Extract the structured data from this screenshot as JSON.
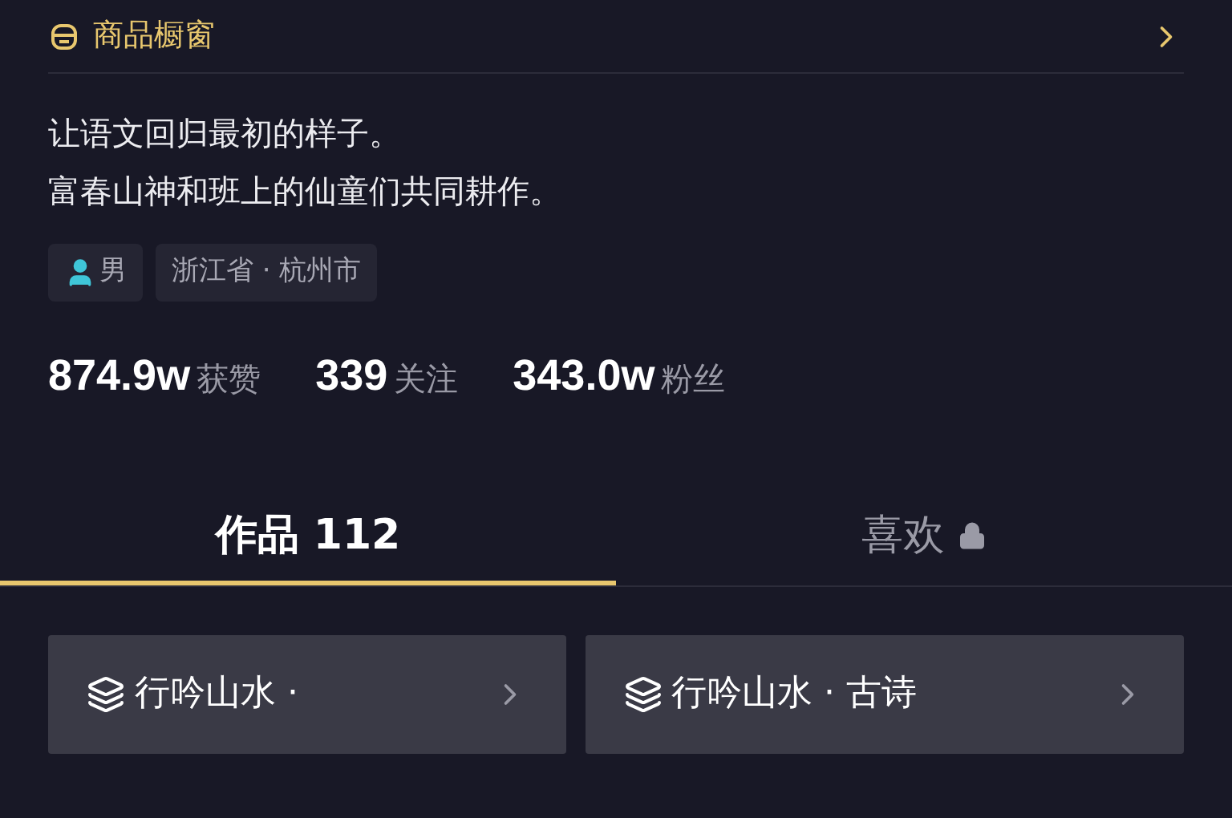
{
  "shop_window": {
    "label": "商品橱窗"
  },
  "bio": [
    "让语文回归最初的样子。",
    "富春山神和班上的仙童们共同耕作。"
  ],
  "tags": [
    {
      "kind": "gender",
      "label": "男"
    },
    {
      "kind": "location",
      "label": "浙江省 · 杭州市"
    }
  ],
  "stats": [
    {
      "count": "874.9w",
      "suffix": "获赞"
    },
    {
      "count": "339",
      "suffix": "关注"
    },
    {
      "count": "343.0w",
      "suffix": "粉丝"
    }
  ],
  "tabs": [
    {
      "label": "作品 112",
      "selected": true,
      "locked": false
    },
    {
      "label": "喜欢",
      "selected": false,
      "locked": true
    }
  ],
  "collections": [
    {
      "title": "行吟山水 ·"
    },
    {
      "title": "行吟山水 · 古诗"
    }
  ]
}
